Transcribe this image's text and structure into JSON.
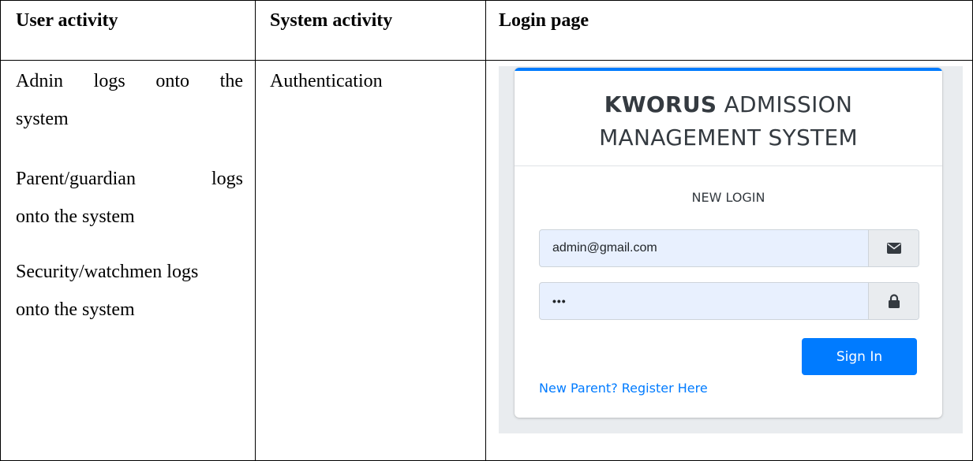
{
  "table": {
    "headers": [
      "User activity",
      "System activity",
      "Login page"
    ],
    "user_activity": {
      "line1_words": [
        "Adnin",
        "logs",
        "onto",
        "the"
      ],
      "line2": "system",
      "line3_words": [
        "Parent/guardian",
        "logs"
      ],
      "line4": "onto the system",
      "line5": "Security/watchmen logs",
      "line6": "onto the system"
    },
    "system_activity": "Authentication"
  },
  "login": {
    "brand_bold": "KWORUS",
    "brand_rest": " ADMISSION",
    "brand_line2": "MANAGEMENT SYSTEM",
    "message": "NEW LOGIN",
    "email_value": "admin@gmail.com",
    "password_value": "•••",
    "signin_label": "Sign In",
    "register_link": "New Parent? Register Here",
    "icons": [
      "envelope-icon",
      "lock-icon"
    ],
    "accent_color": "#007bff"
  }
}
